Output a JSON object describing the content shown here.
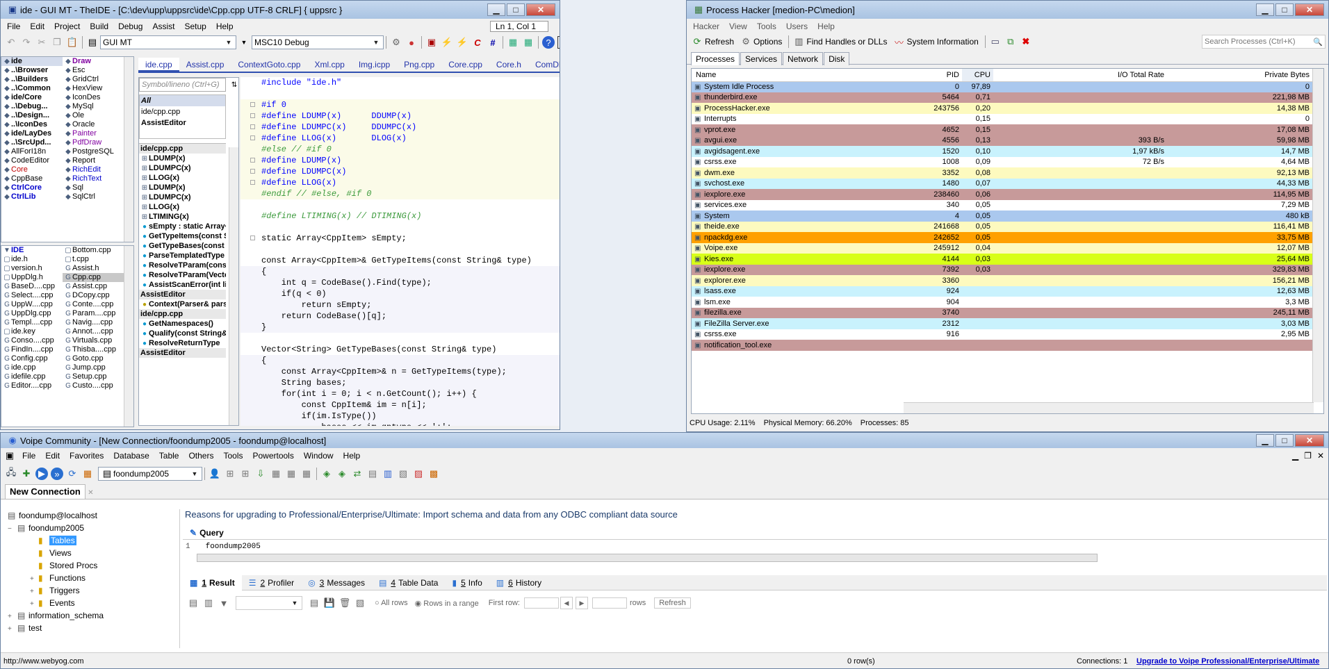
{
  "ide": {
    "title": "ide - GUI MT - TheIDE - [C:\\dev\\upp\\uppsrc\\ide\\Cpp.cpp UTF-8 CRLF] { uppsrc }",
    "menu": [
      "File",
      "Edit",
      "Project",
      "Build",
      "Debug",
      "Assist",
      "Setup",
      "Help"
    ],
    "position": "Ln 1, Col 1",
    "combo_main": "GUI MT",
    "combo_build": "MSC10 Debug",
    "packages_a": [
      "ide",
      "..\\Browser",
      "..\\Builders",
      "..\\Common",
      "ide/Core",
      "..\\Debug...",
      "..\\Design...",
      "..\\IconDes",
      "ide/LayDes",
      "..\\SrcUpd...",
      "AllForI18n",
      "CodeEditor",
      "Core",
      "CppBase",
      "CtrlCore",
      "CtrlLib"
    ],
    "packages_b": [
      "Draw",
      "Esc",
      "GridCtrl",
      "HexView",
      "IconDes",
      "MySql",
      "Ole",
      "Oracle",
      "Painter",
      "PdfDraw",
      "PostgreSQL",
      "Report",
      "RichEdit",
      "RichText",
      "Sql",
      "SqlCtrl"
    ],
    "files_a": [
      "IDE",
      "ide.h",
      "version.h",
      "UppDlg.h",
      "BaseD....cpp",
      "Select....cpp",
      "UppW....cpp",
      "UppDlg.cpp",
      "Templ....cpp",
      "ide.key",
      "Conso....cpp",
      "FindIn....cpp",
      "Config.cpp",
      "ide.cpp",
      "idefile.cpp",
      "Editor....cpp"
    ],
    "files_b": [
      "Bottom.cpp",
      "t.cpp",
      "Assist.h",
      "Cpp.cpp",
      "Assist.cpp",
      "DCopy.cpp",
      "Conte....cpp",
      "Param....cpp",
      "Navig....cpp",
      "Annot....cpp",
      "Virtuals.cpp",
      "Thisba....cpp",
      "Goto.cpp",
      "Jump.cpp",
      "Setup.cpp",
      "Custo....cpp"
    ],
    "tabs": [
      "ide.cpp",
      "Assist.cpp",
      "ContextGoto.cpp",
      "Xml.cpp",
      "Img.icpp",
      "Png.cpp",
      "Core.cpp",
      "Core.h",
      "ComDlg.cpp"
    ],
    "nav_placeholder": "Symbol/lineno (Ctrl+G)",
    "nav_scope": [
      "All",
      "ide/cpp.cpp",
      "AssistEditor"
    ],
    "nav_items": [
      {
        "t": "ide/cpp.cpp",
        "h": true
      },
      {
        "t": "LDUMP(x)"
      },
      {
        "t": "LDUMPC(x)"
      },
      {
        "t": "LLOG(x)"
      },
      {
        "t": "LDUMP(x)"
      },
      {
        "t": "LDUMPC(x)"
      },
      {
        "t": "LLOG(x)"
      },
      {
        "t": "LTIMING(x)"
      },
      {
        "t": "sEmpty : static Array<CppItem>",
        "c": true
      },
      {
        "t": "GetTypeItems(const String& type)",
        "c": true
      },
      {
        "t": "GetTypeBases(const String& type)",
        "c": true
      },
      {
        "t": "ParseTemplatedType",
        "c": true
      },
      {
        "t": "ResolveTParam(const String& type)",
        "c": true
      },
      {
        "t": "ResolveTParam(Vector<String>& type)",
        "c": true
      },
      {
        "t": "AssistScanError(int line)",
        "c": true
      },
      {
        "t": "AssistEditor",
        "h": true
      },
      {
        "t": "Context(Parser& parser)",
        "c": true,
        "y": true
      },
      {
        "t": "ide/cpp.cpp",
        "h": true
      },
      {
        "t": "GetNamespaces()",
        "c": true
      },
      {
        "t": "Qualify(const String& scope)",
        "c": true
      },
      {
        "t": "ResolveReturnType",
        "c": true
      },
      {
        "t": "AssistEditor",
        "h": true
      }
    ],
    "code": [
      "#include \"ide.h\"",
      "",
      "#if 0",
      "#define LDUMP(x)      DDUMP(x)",
      "#define LDUMPC(x)     DDUMPC(x)",
      "#define LLOG(x)       DLOG(x)",
      "#else // #if 0",
      "#define LDUMP(x)",
      "#define LDUMPC(x)",
      "#define LLOG(x)",
      "#endif // #else, #if 0",
      "",
      "#define LTIMING(x) // DTIMING(x)",
      "",
      "static Array<CppItem> sEmpty;",
      "",
      "const Array<CppItem>& GetTypeItems(const String& type)",
      "{",
      "    int q = CodeBase().Find(type);",
      "    if(q < 0)",
      "        return sEmpty;",
      "    return CodeBase()[q];",
      "}",
      "",
      "Vector<String> GetTypeBases(const String& type)",
      "{",
      "    const Array<CppItem>& n = GetTypeItems(type);",
      "    String bases;",
      "    for(int i = 0; i < n.GetCount(); i++) {",
      "        const CppItem& im = n[i];",
      "        if(im.IsType())",
      "            bases << im.qptype << ';';"
    ]
  },
  "ph": {
    "title": "Process Hacker [medion-PC\\medion]",
    "menu": [
      "Hacker",
      "View",
      "Tools",
      "Users",
      "Help"
    ],
    "toolbar": {
      "refresh": "Refresh",
      "options": "Options",
      "find": "Find Handles or DLLs",
      "sysinfo": "System Information",
      "search_placeholder": "Search Processes (Ctrl+K)"
    },
    "tabs": [
      "Processes",
      "Services",
      "Network",
      "Disk"
    ],
    "columns": [
      "Name",
      "PID",
      "CPU",
      "I/O Total Rate",
      "Private Bytes"
    ],
    "processes": [
      {
        "n": "System Idle Process",
        "p": "0",
        "c": "97,89",
        "io": "",
        "m": "0",
        "bg": "#aac8ee"
      },
      {
        "n": "thunderbird.exe",
        "p": "5464",
        "c": "0,71",
        "io": "",
        "m": "221,98 MB",
        "bg": "#c79a9a"
      },
      {
        "n": "ProcessHacker.exe",
        "p": "243756",
        "c": "0,20",
        "io": "",
        "m": "14,38 MB",
        "bg": "#fdfabf"
      },
      {
        "n": "Interrupts",
        "p": "",
        "c": "0,15",
        "io": "",
        "m": "0",
        "bg": "#ffffff"
      },
      {
        "n": "vprot.exe",
        "p": "4652",
        "c": "0,15",
        "io": "",
        "m": "17,08 MB",
        "bg": "#c79a9a"
      },
      {
        "n": "avgui.exe",
        "p": "4556",
        "c": "0,13",
        "io": "393 B/s",
        "m": "59,98 MB",
        "bg": "#c79a9a"
      },
      {
        "n": "avgidsagent.exe",
        "p": "1520",
        "c": "0,10",
        "io": "1,97 kB/s",
        "m": "14,7 MB",
        "bg": "#c9f2fd"
      },
      {
        "n": "csrss.exe",
        "p": "1008",
        "c": "0,09",
        "io": "72 B/s",
        "m": "4,64 MB",
        "bg": "#ffffff"
      },
      {
        "n": "dwm.exe",
        "p": "3352",
        "c": "0,08",
        "io": "",
        "m": "92,13 MB",
        "bg": "#fdfabf"
      },
      {
        "n": "svchost.exe",
        "p": "1480",
        "c": "0,07",
        "io": "",
        "m": "44,33 MB",
        "bg": "#c9f2fd"
      },
      {
        "n": "iexplore.exe",
        "p": "238460",
        "c": "0,06",
        "io": "",
        "m": "114,95 MB",
        "bg": "#c79a9a"
      },
      {
        "n": "services.exe",
        "p": "340",
        "c": "0,05",
        "io": "",
        "m": "7,29 MB",
        "bg": "#ffffff"
      },
      {
        "n": "System",
        "p": "4",
        "c": "0,05",
        "io": "",
        "m": "480 kB",
        "bg": "#aac8ee"
      },
      {
        "n": "theide.exe",
        "p": "241668",
        "c": "0,05",
        "io": "",
        "m": "116,41 MB",
        "bg": "#fdfabf"
      },
      {
        "n": "npackdg.exe",
        "p": "242652",
        "c": "0,05",
        "io": "",
        "m": "33,75 MB",
        "bg": "#ffa000"
      },
      {
        "n": "Voipe.exe",
        "p": "245912",
        "c": "0,04",
        "io": "",
        "m": "12,07 MB",
        "bg": "#fdfabf"
      },
      {
        "n": "Kies.exe",
        "p": "4144",
        "c": "0,03",
        "io": "",
        "m": "25,64 MB",
        "bg": "#d8ff18"
      },
      {
        "n": "iexplore.exe",
        "p": "7392",
        "c": "0,03",
        "io": "",
        "m": "329,83 MB",
        "bg": "#c79a9a"
      },
      {
        "n": "explorer.exe",
        "p": "3360",
        "c": "",
        "io": "",
        "m": "156,21 MB",
        "bg": "#fdfabf"
      },
      {
        "n": "lsass.exe",
        "p": "924",
        "c": "",
        "io": "",
        "m": "12,63 MB",
        "bg": "#c9f2fd"
      },
      {
        "n": "lsm.exe",
        "p": "904",
        "c": "",
        "io": "",
        "m": "3,3 MB",
        "bg": "#ffffff"
      },
      {
        "n": "filezilla.exe",
        "p": "3740",
        "c": "",
        "io": "",
        "m": "245,11 MB",
        "bg": "#c79a9a"
      },
      {
        "n": "FileZilla Server.exe",
        "p": "2312",
        "c": "",
        "io": "",
        "m": "3,03 MB",
        "bg": "#c9f2fd"
      },
      {
        "n": "csrss.exe",
        "p": "916",
        "c": "",
        "io": "",
        "m": "2,95 MB",
        "bg": "#ffffff"
      },
      {
        "n": "notification_tool.exe",
        "p": "",
        "c": "",
        "io": "",
        "m": "",
        "bg": "#c79a9a"
      }
    ],
    "status": {
      "cpu": "CPU Usage: 2.11%",
      "mem": "Physical Memory: 66.20%",
      "procs": "Processes: 85"
    }
  },
  "voipe": {
    "title": "Voipe Community - [New Connection/foondump2005 - foondump@localhost]",
    "menu": [
      "File",
      "Edit",
      "Favorites",
      "Database",
      "Table",
      "Others",
      "Tools",
      "Powertools",
      "Window",
      "Help"
    ],
    "db_combo": "foondump2005",
    "conn_tab": "New Connection",
    "tree": [
      {
        "t": "foondump@localhost",
        "l": 0,
        "e": ""
      },
      {
        "t": "foondump2005",
        "l": 1,
        "e": "−"
      },
      {
        "t": "Tables",
        "l": 2,
        "e": "",
        "sel": true
      },
      {
        "t": "Views",
        "l": 2,
        "e": ""
      },
      {
        "t": "Stored Procs",
        "l": 2,
        "e": ""
      },
      {
        "t": "Functions",
        "l": 2,
        "e": "+"
      },
      {
        "t": "Triggers",
        "l": 2,
        "e": "+"
      },
      {
        "t": "Events",
        "l": 2,
        "e": "+"
      },
      {
        "t": "information_schema",
        "l": 1,
        "e": "+"
      },
      {
        "t": "test",
        "l": 1,
        "e": "+"
      }
    ],
    "banner": "Reasons for upgrading to Professional/Enterprise/Ultimate: Import schema and data from any ODBC compliant data source",
    "query_tab": "Query",
    "query_line_no": "1",
    "query_text": "foondump2005",
    "result_tabs": [
      {
        "n": "1",
        "t": "Result"
      },
      {
        "n": "2",
        "t": "Profiler"
      },
      {
        "n": "3",
        "t": "Messages"
      },
      {
        "n": "4",
        "t": "Table Data"
      },
      {
        "n": "5",
        "t": "Info"
      },
      {
        "n": "6",
        "t": "History"
      }
    ],
    "all_rows": "All rows",
    "rows_range": "Rows in a range",
    "first_row": "First row:",
    "rows": "rows",
    "refresh": "Refresh",
    "status_url": "http://www.webyog.com",
    "status_rows": "0 row(s)",
    "status_conn": "Connections: 1",
    "upgrade": "Upgrade to Voipe Professional/Enterprise/Ultimate"
  }
}
